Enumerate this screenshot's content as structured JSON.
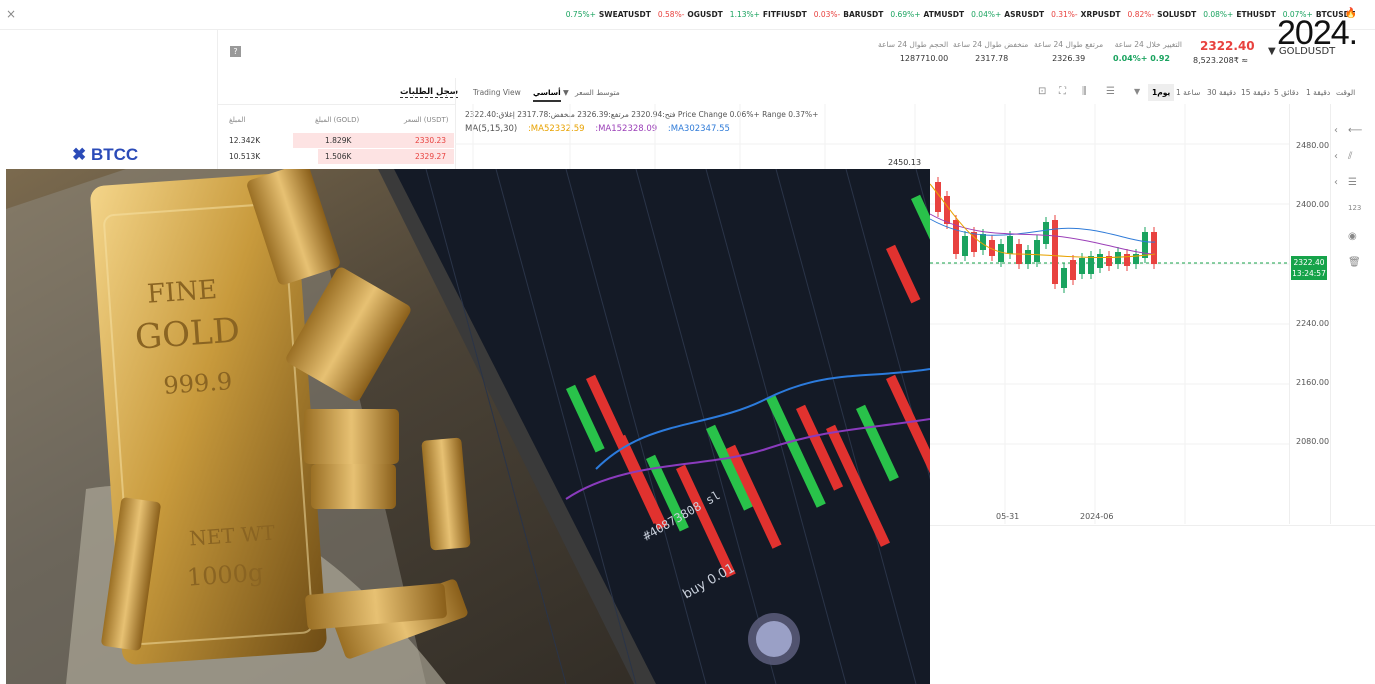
{
  "ticker": {
    "close_label": "×",
    "items": [
      {
        "change": "0.75%+",
        "symbol": "SWEATUSDT",
        "neg": false
      },
      {
        "change": "0.58%-",
        "symbol": "OGUSDT",
        "neg": true
      },
      {
        "change": "1.13%+",
        "symbol": "FITFIUSDT",
        "neg": false
      },
      {
        "change": "0.03%-",
        "symbol": "BARUSDT",
        "neg": true
      },
      {
        "change": "0.69%+",
        "symbol": "ATMUSDT",
        "neg": false
      },
      {
        "change": "0.04%+",
        "symbol": "ASRUSDT",
        "neg": false
      },
      {
        "change": "0.31%-",
        "symbol": "XRPUSDT",
        "neg": true
      },
      {
        "change": "0.82%-",
        "symbol": "SOLUSDT",
        "neg": true
      },
      {
        "change": "0.08%+",
        "symbol": "ETHUSDT",
        "neg": false
      },
      {
        "change": "0.07%+",
        "symbol": "BTCUSDT",
        "neg": false
      }
    ]
  },
  "year_overlay": "2024.",
  "logo": "✖ BTCC",
  "header": {
    "question_mark": "?",
    "stats": [
      {
        "label": "الحجم طوال 24 ساعة",
        "value": "1287710.00"
      },
      {
        "label": "منخفض طوال 24 ساعة",
        "value": "2317.78"
      },
      {
        "label": "مرتفع طوال 24 ساعة",
        "value": "2326.39"
      },
      {
        "label": "التغيير خلال 24 ساعة",
        "value": "0.04%+  0.92"
      }
    ],
    "price": "2322.40",
    "price_sub": "8,523.208₹ ≈",
    "symbol": "GOLDUSDT"
  },
  "toolbar": {
    "left_items": [
      "Trading View",
      "أساسي",
      "متوسط السعر"
    ],
    "timeframes": [
      "الوقت",
      "1 دقيقة",
      "5 دقائق",
      "15 دقيقة",
      "30 دقيقة",
      "1 ساعة",
      "1يوم"
    ]
  },
  "order_book": {
    "title": "سجل الطلبات",
    "headers": [
      "المبلغ",
      "المبلغ (GOLD)",
      "السعر (USDT)"
    ],
    "rows": [
      {
        "amount": "12.342K",
        "qty": "1.829K",
        "price": "2330.23",
        "depth": 0.69
      },
      {
        "amount": "10.513K",
        "qty": "1.506K",
        "price": "2329.27",
        "depth": 0.58
      }
    ]
  },
  "chart_info": {
    "line1": "فتح:2320.94   مرتفع:2326.39   منخفض:2317.78   إغلاق:2322.40   Price Change 0.06%+   Range 0.37%+",
    "ma_label": "MA(5,15,30)",
    "ma1": ":MA52332.59",
    "ma2": ":MA152328.09",
    "ma3": ":MA302347.55"
  },
  "chart_data": {
    "type": "line",
    "title": "",
    "yticks": [
      "2480.00",
      "2400.00",
      "2240.00",
      "2160.00",
      "2080.00"
    ],
    "xticks": [
      "05-31",
      "2024-06"
    ],
    "high_marker": "2450.13",
    "last_price": "2322.40",
    "last_time": "13:24:57"
  },
  "colors": {
    "up": "#1aa35f",
    "down": "#e8423f",
    "accent": "#16a34a"
  }
}
